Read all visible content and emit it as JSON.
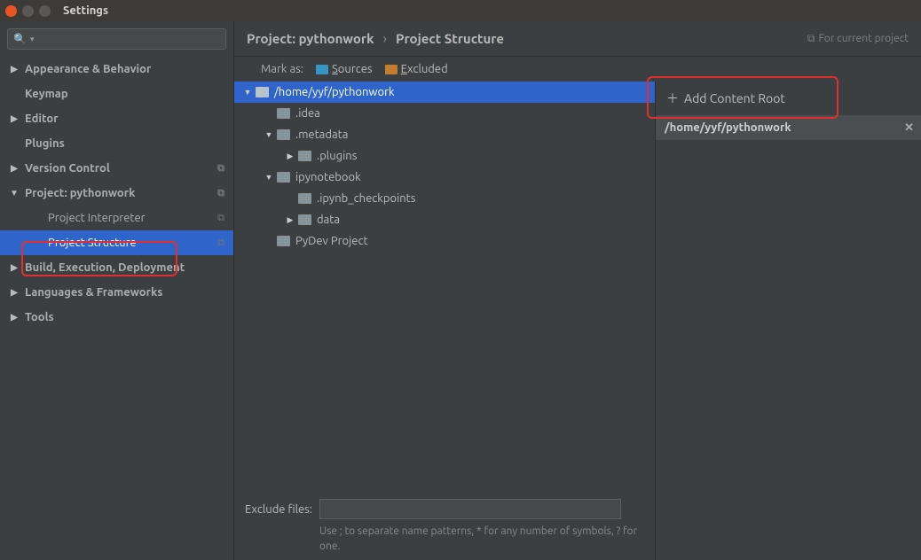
{
  "window": {
    "title": "Settings"
  },
  "search": {
    "placeholder": ""
  },
  "sidebar": {
    "items": [
      {
        "label": "Appearance & Behavior",
        "expandable": true,
        "indent": 0
      },
      {
        "label": "Keymap",
        "expandable": false,
        "indent": 0
      },
      {
        "label": "Editor",
        "expandable": true,
        "indent": 0
      },
      {
        "label": "Plugins",
        "expandable": false,
        "indent": 0
      },
      {
        "label": "Version Control",
        "expandable": true,
        "indent": 0,
        "copy": true
      },
      {
        "label": "Project: pythonwork",
        "expandable": true,
        "expanded": true,
        "indent": 0,
        "copy": true
      },
      {
        "label": "Project Interpreter",
        "expandable": false,
        "indent": 1,
        "copy": true
      },
      {
        "label": "Project Structure",
        "expandable": false,
        "indent": 1,
        "copy": true,
        "selected": true
      },
      {
        "label": "Build, Execution, Deployment",
        "expandable": true,
        "indent": 0
      },
      {
        "label": "Languages & Frameworks",
        "expandable": true,
        "indent": 0
      },
      {
        "label": "Tools",
        "expandable": true,
        "indent": 0
      }
    ]
  },
  "breadcrumb": {
    "a": "Project: pythonwork",
    "b": "Project Structure",
    "tag": "For current project"
  },
  "markbar": {
    "label": "Mark as:",
    "sources": "Sources",
    "excluded": "Excluded"
  },
  "dirs": [
    {
      "label": "/home/yyf/pythonwork",
      "depth": 0,
      "arrow": "down",
      "selected": true
    },
    {
      "label": ".idea",
      "depth": 1,
      "arrow": "none"
    },
    {
      "label": ".metadata",
      "depth": 1,
      "arrow": "down"
    },
    {
      "label": ".plugins",
      "depth": 2,
      "arrow": "right"
    },
    {
      "label": "ipynotebook",
      "depth": 1,
      "arrow": "down"
    },
    {
      "label": ".ipynb_checkpoints",
      "depth": 2,
      "arrow": "none"
    },
    {
      "label": "data",
      "depth": 2,
      "arrow": "right"
    },
    {
      "label": "PyDev Project",
      "depth": 1,
      "arrow": "none"
    }
  ],
  "exclude": {
    "label": "Exclude files:",
    "value": "",
    "hint": "Use ; to separate name patterns, * for any number of symbols, ? for one."
  },
  "rightPanel": {
    "addLabel": "Add Content Root",
    "root": "/home/yyf/pythonwork"
  }
}
